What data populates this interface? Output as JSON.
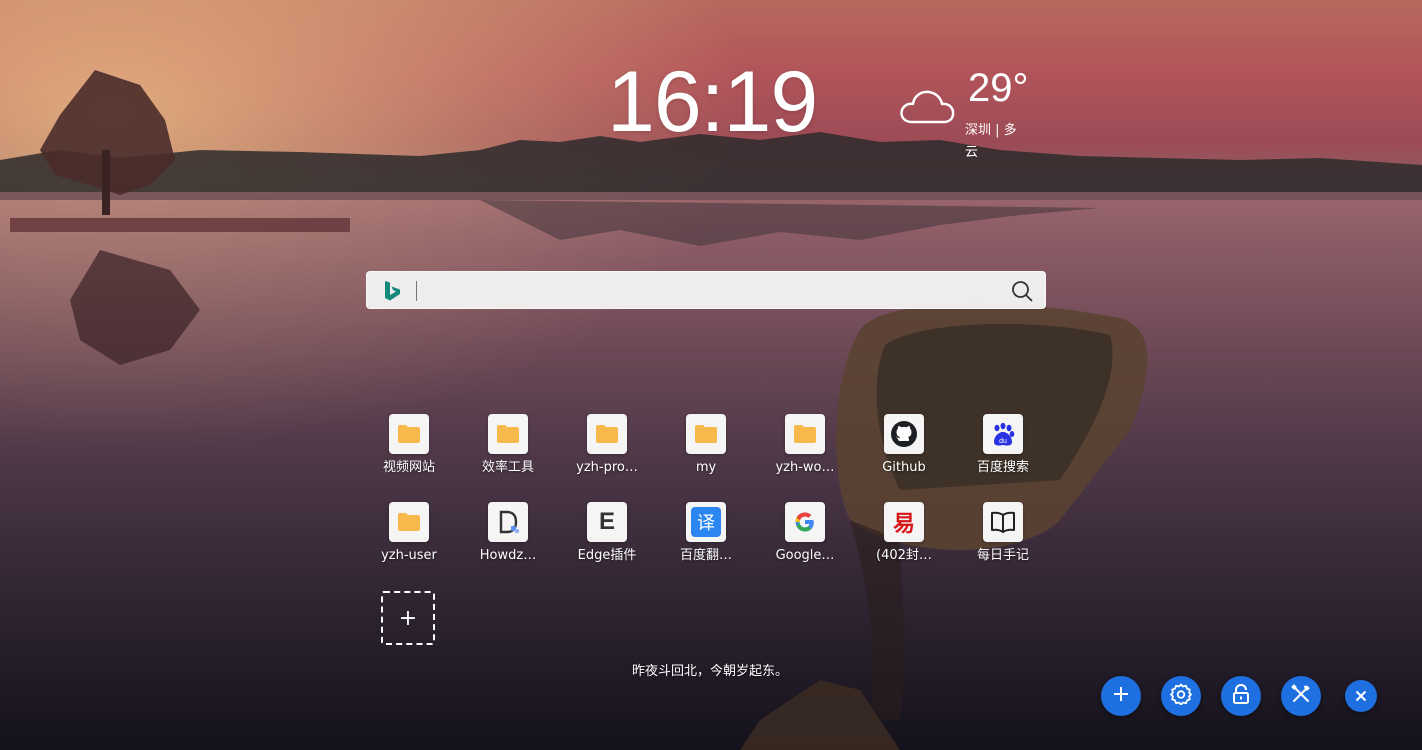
{
  "clock": {
    "time": "16:19"
  },
  "weather": {
    "temperature": "29°",
    "location_condition": "深圳 | 多云",
    "icon": "cloud-icon"
  },
  "search": {
    "engine_icon": "bing-logo-icon",
    "value": "",
    "placeholder": "",
    "search_icon": "magnifier-icon"
  },
  "shortcuts": [
    {
      "label": "视频网站",
      "icon": "folder-icon"
    },
    {
      "label": "效率工具",
      "icon": "folder-icon"
    },
    {
      "label": "yzh-pro…",
      "icon": "folder-icon"
    },
    {
      "label": "my",
      "icon": "folder-icon"
    },
    {
      "label": "yzh-wo…",
      "icon": "folder-icon"
    },
    {
      "label": "Github",
      "icon": "github-icon"
    },
    {
      "label": "百度搜索",
      "icon": "baidu-icon"
    },
    {
      "label": "yzh-user",
      "icon": "folder-icon"
    },
    {
      "label": "Howdz…",
      "icon": "howdz-icon"
    },
    {
      "label": "Edge插件",
      "icon": "edge-e-icon",
      "glyph": "E"
    },
    {
      "label": "百度翻…",
      "icon": "translate-icon",
      "glyph": "译"
    },
    {
      "label": "Google…",
      "icon": "google-icon",
      "glyph": "G"
    },
    {
      "label": "(402封…",
      "icon": "mail163-icon",
      "glyph": "易"
    },
    {
      "label": "每日手记",
      "icon": "book-icon"
    }
  ],
  "add_shortcut": {
    "label": "+"
  },
  "quote": "昨夜斗回北，今朝岁起东。",
  "actions": [
    {
      "name": "add",
      "icon": "plus-icon"
    },
    {
      "name": "settings",
      "icon": "gear-icon"
    },
    {
      "name": "lock",
      "icon": "lock-icon"
    },
    {
      "name": "tools",
      "icon": "tools-icon"
    },
    {
      "name": "close",
      "icon": "close-icon"
    }
  ],
  "colors": {
    "accent": "#1e6fe0",
    "folder": "#f7b84c",
    "bing": "#138a7c"
  }
}
